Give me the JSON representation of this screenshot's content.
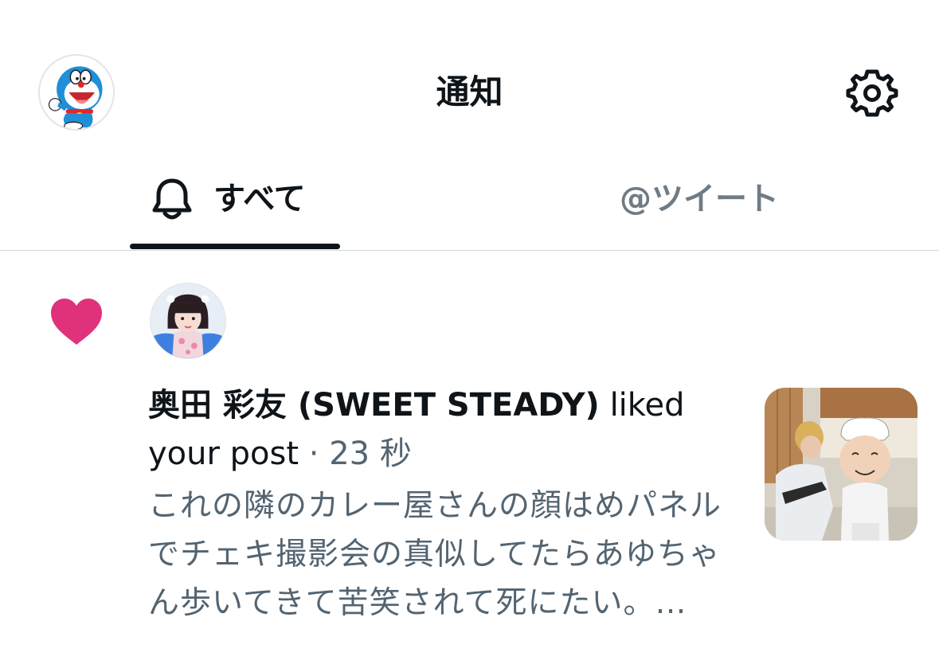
{
  "header": {
    "title": "通知",
    "avatar_icon": "user-avatar",
    "settings_icon": "gear-icon"
  },
  "tabs": [
    {
      "label": "すべて",
      "icon": "bell-icon",
      "active": true
    },
    {
      "label": "@ツイート",
      "active": false
    }
  ],
  "notifications": [
    {
      "type": "like",
      "icon": "heart-icon",
      "user_name": "奥田 彩友 (SWEET STEADY)",
      "action": "liked your post",
      "separator": "·",
      "time": "23 秒",
      "post_text": "これの隣のカレー屋さんの顔はめパネルでチェキ撮影会の真似してたらあゆちゃん歩いてきて苦笑されて死にたい。…"
    }
  ],
  "colors": {
    "heart": "#e0327a",
    "text_primary": "#0f1419",
    "text_secondary": "#536471",
    "tab_inactive": "#6f7b85",
    "divider": "#cfd9de",
    "tab_indicator": "#0f1419"
  }
}
